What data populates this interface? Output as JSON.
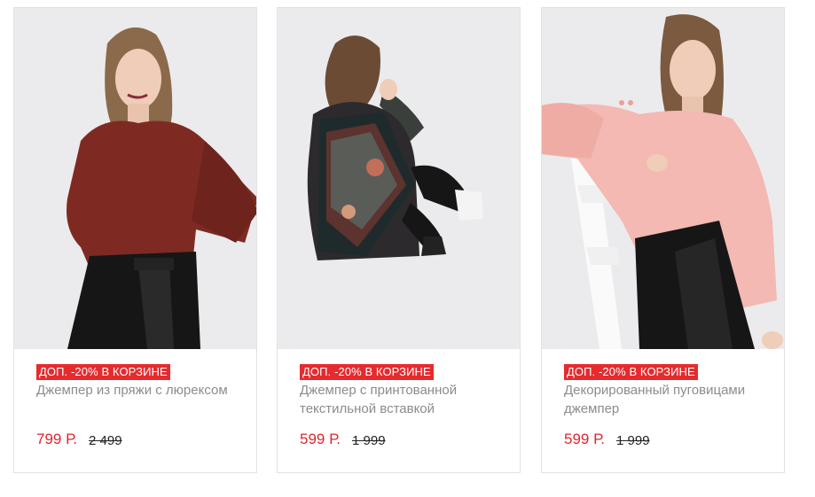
{
  "products": [
    {
      "badge": "ДОП. -20% В КОРЗИНЕ",
      "title": "Джемпер из пряжи с люрексом",
      "price": "799 Р.",
      "old_price": "2 499",
      "image": {
        "type": "product-photo",
        "colors": {
          "garment": "#7e2a22",
          "pants": "#1a1a1a",
          "hair": "#8a6a4a",
          "skin": "#efcdb8"
        }
      }
    },
    {
      "badge": "ДОП. -20% В КОРЗИНЕ",
      "title": "Джемпер с принтованной текстильной вставкой",
      "price": "599 Р.",
      "old_price": "1 999",
      "image": {
        "type": "product-photo",
        "colors": {
          "garment": "#3b3f3c",
          "print": "#8e3b32",
          "hair": "#6b4b34",
          "shoes": "#f4f4f4"
        }
      }
    },
    {
      "badge": "ДОП. -20% В КОРЗИНЕ",
      "title": "Декорированный пуговицами джемпер",
      "price": "599 Р.",
      "old_price": "1 999",
      "image": {
        "type": "product-photo",
        "colors": {
          "garment": "#f3b9b2",
          "pants": "#161616",
          "hair": "#7b5a3f",
          "chair": "#fafafa"
        }
      }
    }
  ],
  "colors": {
    "accent": "#e52b2e",
    "price": "#e0262b",
    "title": "#8c8c8c",
    "border": "#e2e2e2",
    "photo_bg": "#e9e9eb"
  }
}
